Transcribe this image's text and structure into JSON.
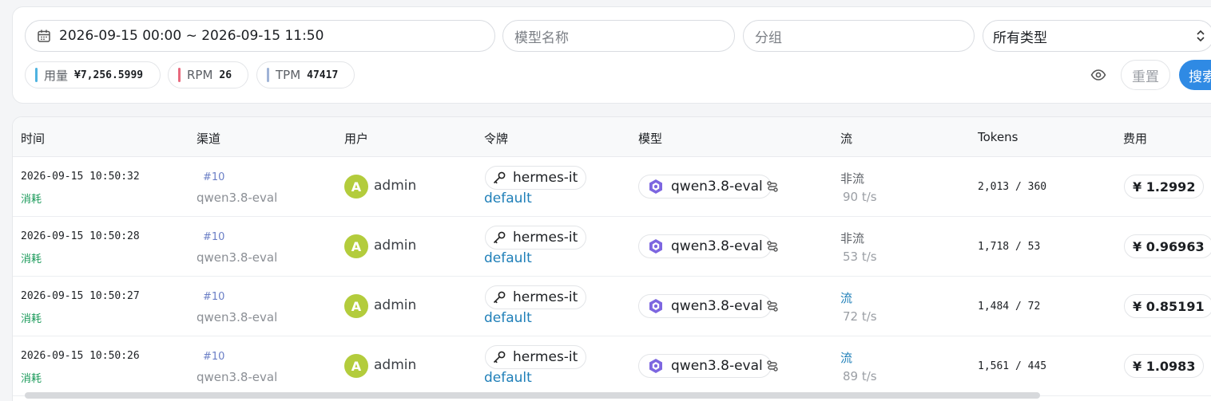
{
  "filters": {
    "date_range": "2026-09-15 00:00 ~ 2026-09-15 11:50",
    "model_placeholder": "模型名称",
    "group_placeholder": "分组",
    "type_value": "所有类型"
  },
  "stats": [
    {
      "label": "用量",
      "value": "¥7,256.5999",
      "color": "#4fb3e0"
    },
    {
      "label": "RPM",
      "value": "26",
      "color": "#e8697d"
    },
    {
      "label": "TPM",
      "value": "47417",
      "color": "#9fb3d6"
    }
  ],
  "actions": {
    "reset_label": "重置",
    "search_label": "搜索"
  },
  "table": {
    "headers": {
      "time": "时间",
      "channel": "渠道",
      "user": "用户",
      "token": "令牌",
      "model": "模型",
      "stream": "流",
      "tokens": "Tokens",
      "cost": "费用"
    },
    "rows": [
      {
        "time": "2026-09-15 10:50:32",
        "kind": "消耗",
        "channel_id": "#10",
        "channel_name": "qwen3.8-eval",
        "avatar": "A",
        "user": "admin",
        "token_name": "hermes-it",
        "token_group": "default",
        "model": "qwen3.8-eval",
        "stream": "非流",
        "speed": "90 t/s",
        "tokens": "2,013 / 360",
        "cost": "¥ 1.2992"
      },
      {
        "time": "2026-09-15 10:50:28",
        "kind": "消耗",
        "channel_id": "#10",
        "channel_name": "qwen3.8-eval",
        "avatar": "A",
        "user": "admin",
        "token_name": "hermes-it",
        "token_group": "default",
        "model": "qwen3.8-eval",
        "stream": "非流",
        "speed": "53 t/s",
        "tokens": "1,718 / 53",
        "cost": "¥ 0.96963"
      },
      {
        "time": "2026-09-15 10:50:27",
        "kind": "消耗",
        "channel_id": "#10",
        "channel_name": "qwen3.8-eval",
        "avatar": "A",
        "user": "admin",
        "token_name": "hermes-it",
        "token_group": "default",
        "model": "qwen3.8-eval",
        "stream": "流",
        "speed": "72 t/s",
        "tokens": "1,484 / 72",
        "cost": "¥ 0.85191"
      },
      {
        "time": "2026-09-15 10:50:26",
        "kind": "消耗",
        "channel_id": "#10",
        "channel_name": "qwen3.8-eval",
        "avatar": "A",
        "user": "admin",
        "token_name": "hermes-it",
        "token_group": "default",
        "model": "qwen3.8-eval",
        "stream": "流",
        "speed": "89 t/s",
        "tokens": "1,561 / 445",
        "cost": "¥ 1.0983"
      }
    ]
  }
}
